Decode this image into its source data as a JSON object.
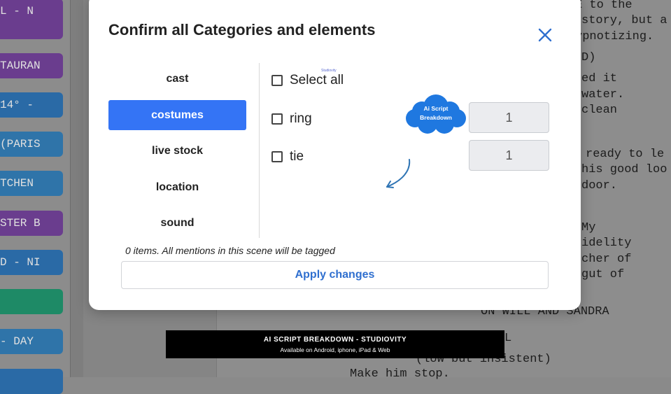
{
  "background": {
    "scenes": [
      {
        "label": "L - N",
        "color": "purple"
      },
      {
        "label": "TAURAN",
        "color": "purple"
      },
      {
        "label": "14° -",
        "color": "blue"
      },
      {
        "label": "(PARIS",
        "color": "blue2"
      },
      {
        "label": "TCHEN",
        "color": "blue2"
      },
      {
        "label": "STER B",
        "color": "purple"
      },
      {
        "label": "D - NI",
        "color": "blue"
      },
      {
        "label": "",
        "color": "green"
      },
      {
        "label": " - DAY",
        "color": "blue2"
      }
    ],
    "script_lines": [
      {
        "text": "E to the",
        "line": 1
      },
      {
        "text": "story, but a",
        "line": 2
      },
      {
        "text": "ypnotizing.",
        "line": 3
      },
      {
        "text": "D)",
        "line": 4
      },
      {
        "text": "ed it",
        "line": 5
      },
      {
        "text": "water.",
        "line": 6
      },
      {
        "text": "clean",
        "line": 7
      },
      {
        "text": "ready to le",
        "line": 8
      },
      {
        "text": "his good loo",
        "line": 9
      },
      {
        "text": "door.",
        "line": 10
      },
      {
        "text": "My",
        "line": 11
      },
      {
        "text": "idelity",
        "line": 12
      },
      {
        "text": "cher of",
        "line": 13
      },
      {
        "text": "gut of",
        "line": 14
      },
      {
        "text": "ON WILL AND SANDRA",
        "line": 15
      },
      {
        "text": "L",
        "line": 16
      },
      {
        "text": "(low but insistent)",
        "line": 17
      },
      {
        "text": "Make him stop.",
        "line": 18
      }
    ]
  },
  "modal": {
    "title": "Confirm all Categories and elements",
    "close_icon": "close-icon",
    "categories": [
      {
        "label": "cast",
        "active": false
      },
      {
        "label": "costumes",
        "active": true
      },
      {
        "label": "live stock",
        "active": false
      },
      {
        "label": "location",
        "active": false
      },
      {
        "label": "sound",
        "active": false
      }
    ],
    "select_all_label": "Select all",
    "elements": [
      {
        "label": "ring",
        "count": "1",
        "checked": false
      },
      {
        "label": "tie",
        "count": "1",
        "checked": false
      }
    ],
    "watermark_small": "Studiovity",
    "cloud_badge": {
      "line1": "Ai Script",
      "line2": "Breakdown"
    },
    "items_note": "0 items. All mentions in this scene will be tagged",
    "apply_label": "Apply changes"
  },
  "banner": {
    "title": "AI SCRIPT BREAKDOWN - STUDIOVITY",
    "subtitle": "Available on Android, iphone, iPad & Web"
  },
  "colors": {
    "accent": "#3474f5",
    "apply_text": "#2f6fcf"
  }
}
